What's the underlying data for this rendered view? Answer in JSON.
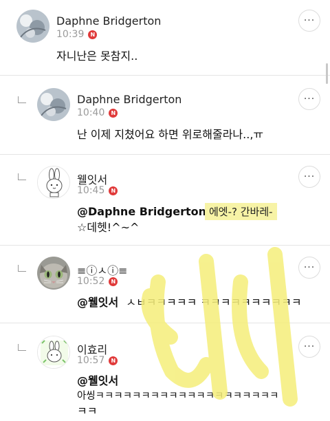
{
  "comments": [
    {
      "name": "Daphne Bridgerton",
      "time": "10:39",
      "badge": "N",
      "text": "자니난은 못참지..",
      "more": "···"
    },
    {
      "name": "Daphne Bridgerton",
      "time": "10:40",
      "badge": "N",
      "text": "난 이제 지쳤어요 하면 위로해줄라나..,ㅠ",
      "more": "···"
    },
    {
      "name": "웰잇서",
      "time": "10:45",
      "badge": "N",
      "mention": "@Daphne Bridgerton",
      "text_line2": "☆데헷!^~^",
      "highlight": "에엣-? 간바레-",
      "more": "···"
    },
    {
      "name": "≡ⓘㅅⓘ≡",
      "time": "10:52",
      "badge": "N",
      "mention": "@웰잇서",
      "text": "ㅅㅂㅋㅋㅋㅋㅋ ㅋㅋㅋㅋㅋㅋㅋㅋㅋㅋ",
      "more": "···"
    },
    {
      "name": "이효리",
      "time": "10:57",
      "badge": "N",
      "mention": "@웰잇서",
      "text_line2": "아씽ㅋㅋㅋㅋㅋㅋㅋㅋㅋㅋㅋㅋㅋㅋㅋㅋㅋㅋㅋㅋ",
      "text_line3": "ㅋㅋ",
      "more": "···"
    }
  ],
  "colors": {
    "badge": "#e03a3a",
    "highlight": "#f7f3a6",
    "watermark": "#f5ee7a"
  },
  "icons": {
    "badge": "new-badge-icon",
    "more": "more-horizontal-icon",
    "reply": "reply-indent-icon"
  }
}
